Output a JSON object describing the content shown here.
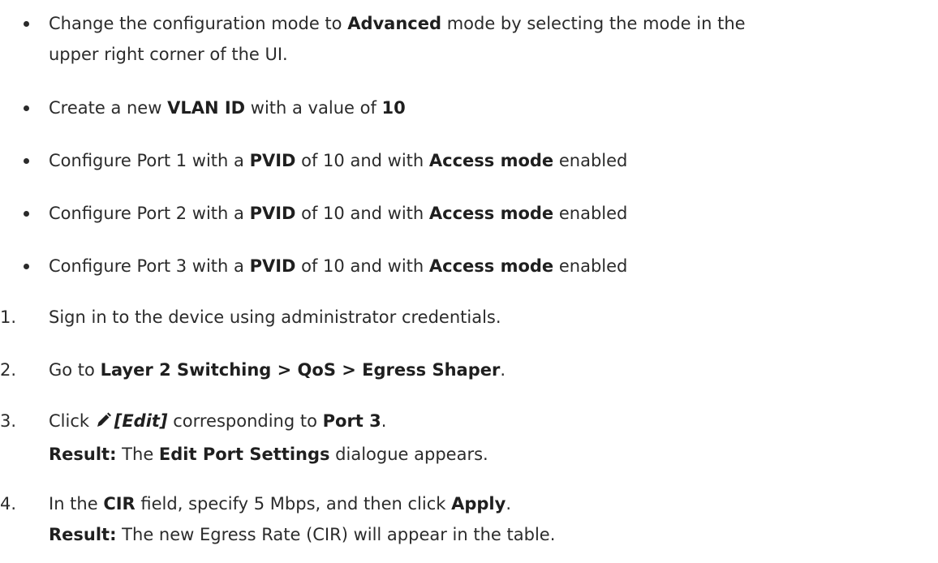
{
  "bullets": [
    {
      "lines": [
        {
          "t1": "Change the configuration mode to ",
          "b1": "Advanced",
          "t2": " mode by selecting the mode in the"
        },
        {
          "t1": "upper right corner of the UI."
        }
      ]
    },
    {
      "t1": "Create a new ",
      "b1": "VLAN ID",
      "t2": " with a value of ",
      "b2": "10"
    },
    {
      "t1": "Configure Port 1 with a ",
      "b1": "PVID",
      "t2": " of 10 and with ",
      "b2": "Access mode",
      "t3": " enabled"
    },
    {
      "t1": "Configure Port 2 with a ",
      "b1": "PVID",
      "t2": " of 10 and with ",
      "b2": "Access mode",
      "t3": " enabled"
    },
    {
      "t1": "Configure Port 3 with a ",
      "b1": "PVID",
      "t2": " of 10 and with ",
      "b2": "Access mode",
      "t3": " enabled"
    }
  ],
  "steps": [
    {
      "num": "1.",
      "t1": "Sign in to the device using administrator credentials."
    },
    {
      "num": "2.",
      "t1": "Go to ",
      "b1": "Layer 2 Switching > QoS > Egress Shaper",
      "t2": "."
    },
    {
      "num": "3.",
      "t1": "Click ",
      "icon": "pencil-edit-icon",
      "bi1": "[Edit]",
      "t2": " corresponding to ",
      "b1": "Port 3",
      "t3": ".",
      "result_label": "Result:",
      "r1": " The ",
      "rb1": "Edit Port Settings",
      "r2": " dialogue appears."
    },
    {
      "num": "4.",
      "t1": "In the ",
      "b1": "CIR",
      "t2": " field, specify 5 Mbps, and then click ",
      "b2": "Apply",
      "t3": ".",
      "result_label": "Result:",
      "r1": " The new Egress Rate (CIR) will appear in the table."
    }
  ]
}
